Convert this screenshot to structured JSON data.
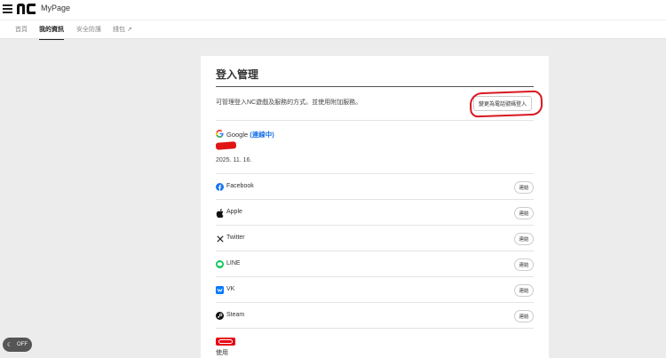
{
  "header": {
    "brand_label": "MyPage"
  },
  "tabs": [
    {
      "label": "首頁"
    },
    {
      "label": "我的資訊"
    },
    {
      "label": "安全防護"
    },
    {
      "label": "錢包 ↗"
    }
  ],
  "login_management": {
    "title": "登入管理",
    "description": "可管理登入NC遊戲及服務的方式。並使用附加服務。",
    "phone_button_label": "變更為電話號碼登入",
    "google": {
      "name": "Google",
      "status": "(連線中)",
      "date": "2025. 11. 16."
    },
    "providers": [
      {
        "name": "Facebook",
        "button": "連結",
        "icon": "facebook-icon",
        "color": "#1877f2"
      },
      {
        "name": "Apple",
        "button": "連結",
        "icon": "apple-icon",
        "color": "#111111"
      },
      {
        "name": "Twitter",
        "button": "連結",
        "icon": "x-twitter-icon",
        "color": "#222222"
      },
      {
        "name": "LINE",
        "button": "連結",
        "icon": "line-icon",
        "color": "#06c755"
      },
      {
        "name": "VK",
        "button": "連結",
        "icon": "vk-icon",
        "color": "#0077ff"
      },
      {
        "name": "Steam",
        "button": "連結",
        "icon": "steam-icon",
        "color": "#111111"
      }
    ],
    "nintendo_use_label": "使用"
  },
  "dark_mode_toggle": {
    "label": "OFF"
  }
}
